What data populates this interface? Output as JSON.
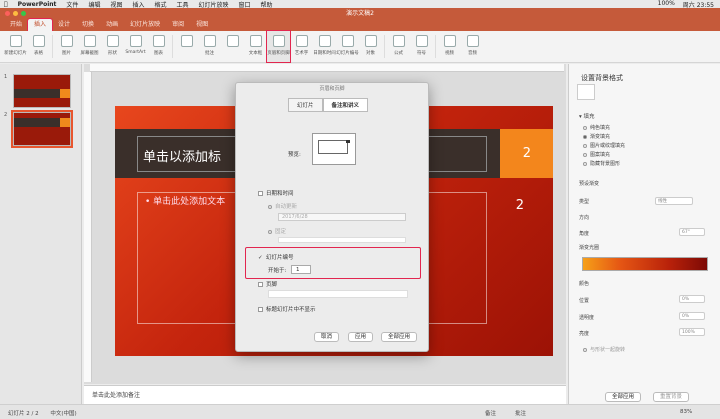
{
  "menubar": {
    "app": "PowerPoint",
    "items": [
      "文件",
      "编辑",
      "视图",
      "插入",
      "格式",
      "工具",
      "幻灯片放映",
      "窗口",
      "帮助"
    ],
    "right": [
      "100%",
      "周六 23:55"
    ]
  },
  "window": {
    "title": "演示文稿2"
  },
  "ribbon_tabs": [
    "开始",
    "插入",
    "设计",
    "切换",
    "动画",
    "幻灯片放映",
    "审阅",
    "视图"
  ],
  "ribbon_buttons": [
    "新建幻灯片",
    "表格",
    "图片",
    "屏幕截图",
    "形状",
    "SmartArt",
    "图表",
    "",
    "批注",
    "",
    "文本框",
    "页眉和页脚",
    "艺术字",
    "日期和时间",
    "幻灯片编号",
    "对象",
    "公式",
    "符号",
    "视频",
    "音频"
  ],
  "thumbnails": {
    "nums": [
      "1",
      "2"
    ]
  },
  "slide": {
    "title": "单击以添加标",
    "num_top": "2",
    "bullet": "• 单击此处添加文本",
    "num_body": "2"
  },
  "notes": {
    "placeholder": "单击此处添加备注"
  },
  "dialog": {
    "title": "页眉和页脚",
    "tabs": [
      "幻灯片",
      "备注和讲义"
    ],
    "preview_label": "预览:",
    "date_time": "日期和时间",
    "auto_update": "自动更新",
    "date_value": "2017/6/28",
    "fixed": "固定",
    "slide_number": "幻灯片编号",
    "start_at_label": "开始于:",
    "start_at_value": "1",
    "footer": "页脚",
    "hide_title": "标题幻灯片中不显示",
    "cancel": "取消",
    "apply": "应用",
    "apply_all": "全部应用"
  },
  "pane": {
    "title": "设置背景格式",
    "fill": "填充",
    "options": [
      "纯色填充",
      "渐变填充",
      "图片或纹理填充",
      "图案填充",
      "隐藏背景图形"
    ],
    "preset": "预设渐变",
    "type_label": "类型",
    "type_value": "线性",
    "direction": "方向",
    "angle_label": "角度",
    "angle_value": "67°",
    "stops": "渐变光圈",
    "color": "颜色",
    "position": "位置",
    "position_value": "0%",
    "transparency": "透明度",
    "transparency_value": "0%",
    "brightness": "亮度",
    "brightness_value": "100%",
    "rotate": "与形状一起旋转",
    "apply_all": "全部应用",
    "reset": "重置背景"
  },
  "status": {
    "slide": "幻灯片 2 / 2",
    "lang": "中文(中国)",
    "notes": "备注",
    "comments": "批注",
    "zoom": "83%"
  },
  "colors": {
    "accent": "#c55a3a",
    "highlight": "#e2264f"
  }
}
